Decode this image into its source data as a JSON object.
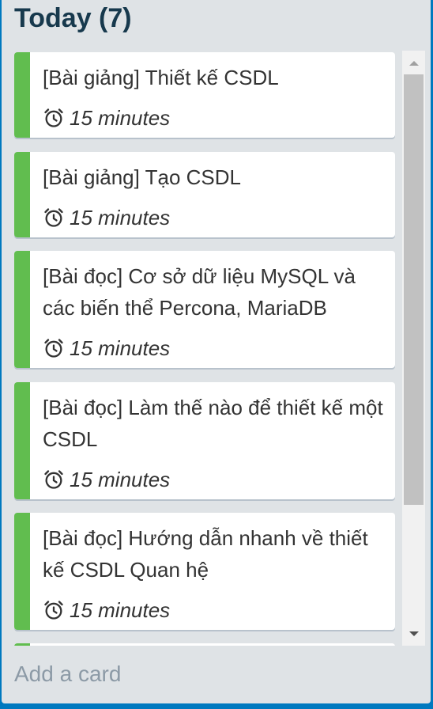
{
  "list": {
    "title": "Today (7)",
    "add_card_label": "Add a card"
  },
  "cards": [
    {
      "title": "[Bài giảng] Thiết kế CSDL",
      "duration": "15 minutes",
      "label_color": "#61bd4f"
    },
    {
      "title": "[Bài giảng] Tạo CSDL",
      "duration": "15 minutes",
      "label_color": "#61bd4f"
    },
    {
      "title": "[Bài đọc] Cơ sở dữ liệu MySQL và các biến thể Percona, MariaDB",
      "duration": "15 minutes",
      "label_color": "#61bd4f"
    },
    {
      "title": "[Bài đọc] Làm thế nào để thiết kế một CSDL",
      "duration": "15 minutes",
      "label_color": "#61bd4f"
    },
    {
      "title": "[Bài đọc] Hướng dẫn nhanh về thiết kế CSDL Quan hệ",
      "duration": "15 minutes",
      "label_color": "#61bd4f"
    }
  ],
  "icons": {
    "duration": "alarm-clock-icon",
    "scroll_up": "arrow-up-icon",
    "scroll_down": "arrow-down-icon"
  },
  "colors": {
    "board_background": "#0079bf",
    "list_background": "#dfe3e6",
    "label_green": "#61bd4f"
  }
}
